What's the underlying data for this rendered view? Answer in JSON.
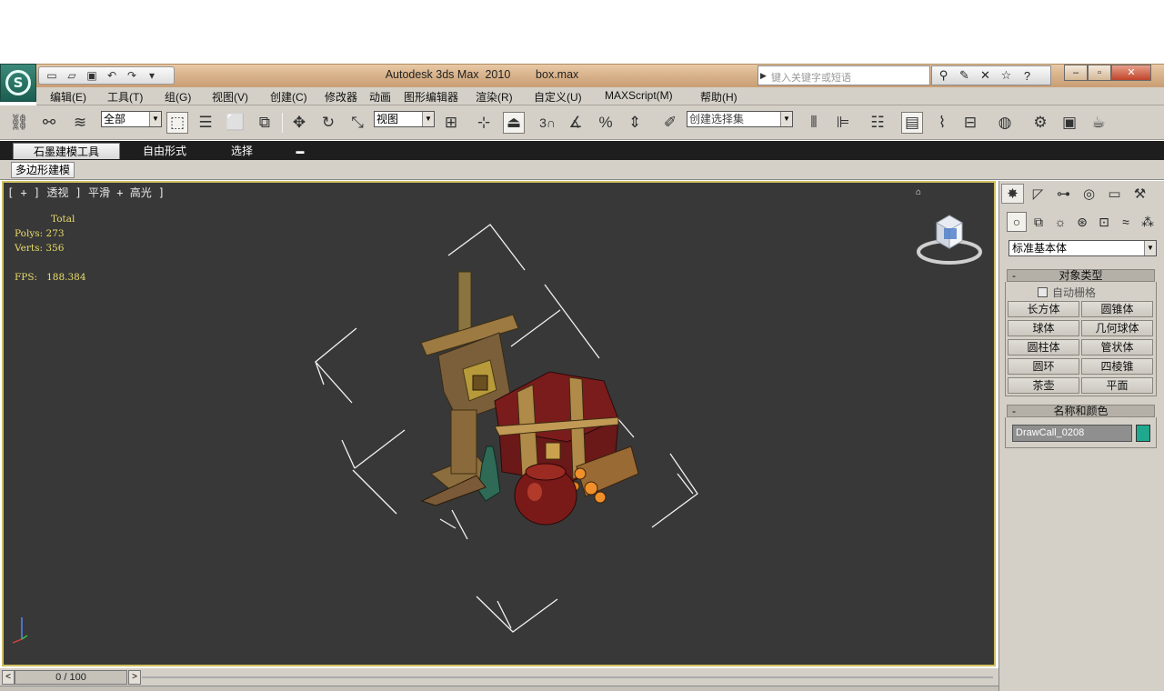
{
  "app": {
    "window_title": "Autodesk 3ds Max  2010        box.max",
    "search_placeholder": "键入关键字或短语"
  },
  "quick_access": [
    "new-file-icon",
    "open-file-icon",
    "save-icon",
    "undo-icon",
    "redo-icon",
    "customize-dropdown-icon"
  ],
  "menu": [
    {
      "label": "编辑(E)"
    },
    {
      "label": "工具(T)"
    },
    {
      "label": "组(G)"
    },
    {
      "label": "视图(V)"
    },
    {
      "label": "创建(C)"
    },
    {
      "label": "修改器"
    },
    {
      "label": "动画"
    },
    {
      "label": "图形编辑器"
    },
    {
      "label": "渲染(R)"
    },
    {
      "label": "自定义(U)"
    },
    {
      "label": "MAXScript(M)"
    },
    {
      "label": "帮助(H)"
    }
  ],
  "toolbar": {
    "selection_filter": "全部",
    "reference_coord": "视图",
    "named_selection": "创建选择集",
    "snap_label": "3"
  },
  "ribbon": {
    "tabs": [
      "石墨建模工具",
      "自由形式",
      "选择"
    ],
    "panel_tab": "多边形建模"
  },
  "viewport": {
    "label": "[ + ] 透视 ] 平滑 + 高光 ]",
    "stats_total": "Total",
    "stats_polys": "Polys: 273",
    "stats_verts": "Verts: 356",
    "stats_fps": "FPS:   188.384"
  },
  "command_panel": {
    "category": "标准基本体",
    "object_type_title": "对象类型",
    "autogrid_label": "自动栅格",
    "object_buttons": [
      "长方体",
      "圆锥体",
      "球体",
      "几何球体",
      "圆柱体",
      "管状体",
      "圆环",
      "四棱锥",
      "茶壶",
      "平面"
    ],
    "name_color_title": "名称和颜色",
    "object_name": "DrawCall_0208",
    "object_color": "#1fa88e"
  },
  "time_slider": {
    "frame_display": "0 / 100"
  },
  "colors": {
    "viewport_bg": "#383838",
    "active_viewport_border": "#d0c060",
    "stats_text": "#e8dc6a",
    "ui_gray": "#d4d0c8"
  }
}
